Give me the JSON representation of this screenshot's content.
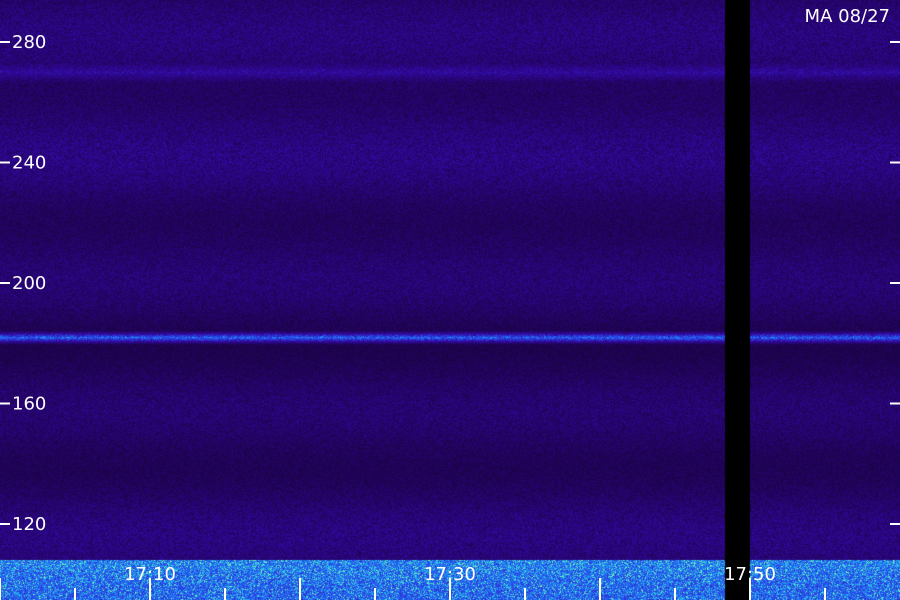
{
  "chart_data": {
    "type": "heatmap",
    "title": "",
    "xlabel": "",
    "ylabel": "",
    "station_label": "MA 08/27",
    "y_axis": {
      "unit": "",
      "range": [
        110,
        290
      ],
      "ticks": [
        280,
        240,
        200,
        160,
        120
      ]
    },
    "x_axis": {
      "unit": "time",
      "range": [
        "17:00",
        "17:59"
      ],
      "labeled_ticks": [
        "17:10",
        "17:30",
        "17:50"
      ],
      "minor_tick_interval_min": 5
    },
    "features": [
      {
        "kind": "horizontal-band",
        "y": 182,
        "strength": "strong"
      },
      {
        "kind": "horizontal-band",
        "y": 270,
        "strength": "faint"
      },
      {
        "kind": "data-gap",
        "x_start": "17:48:20",
        "x_end": "17:50:00"
      },
      {
        "kind": "broadband-noise-floor",
        "y_range": [
          110,
          122
        ]
      }
    ],
    "colors": {
      "background": "#000000",
      "low": "#2a0a6e",
      "mid": "#3b2fd6",
      "high": "#2f8dff",
      "peak": "#7dffb0"
    },
    "grid": false
  }
}
